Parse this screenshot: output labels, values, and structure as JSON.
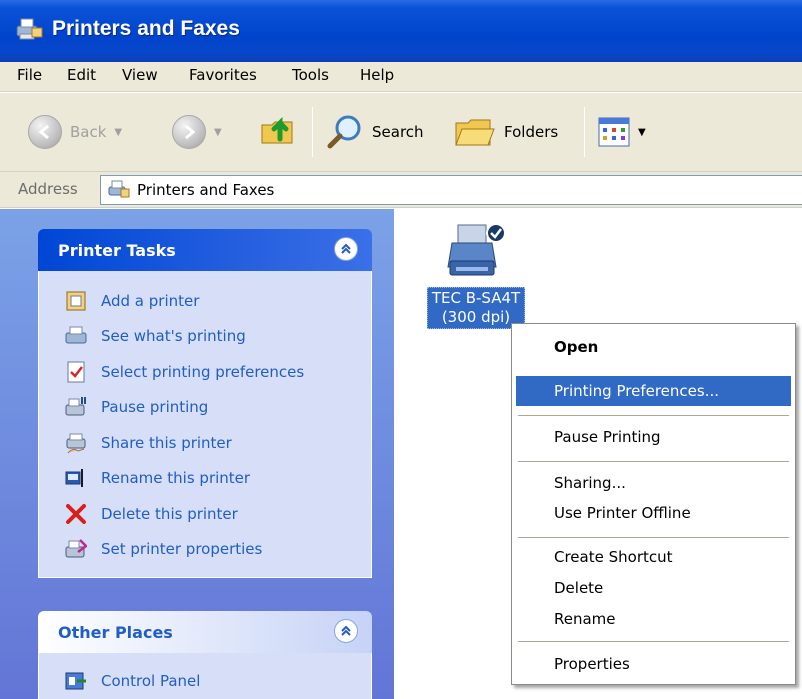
{
  "window": {
    "title": "Printers and Faxes"
  },
  "menu": [
    "File",
    "Edit",
    "View",
    "Favorites",
    "Tools",
    "Help"
  ],
  "toolbar": {
    "back": "Back",
    "search": "Search",
    "folders": "Folders",
    "icons": [
      "back-arrow-icon",
      "forward-arrow-icon",
      "up-folder-icon",
      "search-icon",
      "folders-icon",
      "views-icon"
    ]
  },
  "address": {
    "label": "Address",
    "value": "Printers and Faxes"
  },
  "printer_tasks": {
    "title": "Printer Tasks",
    "items": [
      {
        "label": "Add a printer",
        "icon": "add-printer-icon"
      },
      {
        "label": "See what's printing",
        "icon": "print-queue-icon"
      },
      {
        "label": "Select printing preferences",
        "icon": "preferences-icon"
      },
      {
        "label": "Pause printing",
        "icon": "pause-printer-icon"
      },
      {
        "label": "Share this printer",
        "icon": "share-printer-icon"
      },
      {
        "label": "Rename this printer",
        "icon": "rename-icon"
      },
      {
        "label": "Delete this printer",
        "icon": "delete-icon"
      },
      {
        "label": "Set printer properties",
        "icon": "printer-properties-icon"
      }
    ]
  },
  "other_places": {
    "title": "Other Places",
    "items": [
      {
        "label": "Control Panel",
        "icon": "control-panel-icon"
      }
    ]
  },
  "printer": {
    "name_line1": "TEC B-SA4T",
    "name_line2": "(300 dpi)",
    "default": true
  },
  "context_menu": {
    "items": [
      {
        "label": "Open",
        "bold": true
      },
      {
        "label": "Printing Preferences...",
        "selected": true
      },
      {
        "separator": true
      },
      {
        "label": "Pause Printing"
      },
      {
        "separator": true
      },
      {
        "label": "Sharing..."
      },
      {
        "label": "Use Printer Offline"
      },
      {
        "separator": true
      },
      {
        "label": "Create Shortcut"
      },
      {
        "label": "Delete"
      },
      {
        "label": "Rename"
      },
      {
        "separator": true
      },
      {
        "label": "Properties"
      }
    ]
  },
  "colors": {
    "title_bar": "#0a53d8",
    "selection": "#316ac5",
    "task_link": "#215dc6",
    "task_pane": "#6375d6"
  }
}
